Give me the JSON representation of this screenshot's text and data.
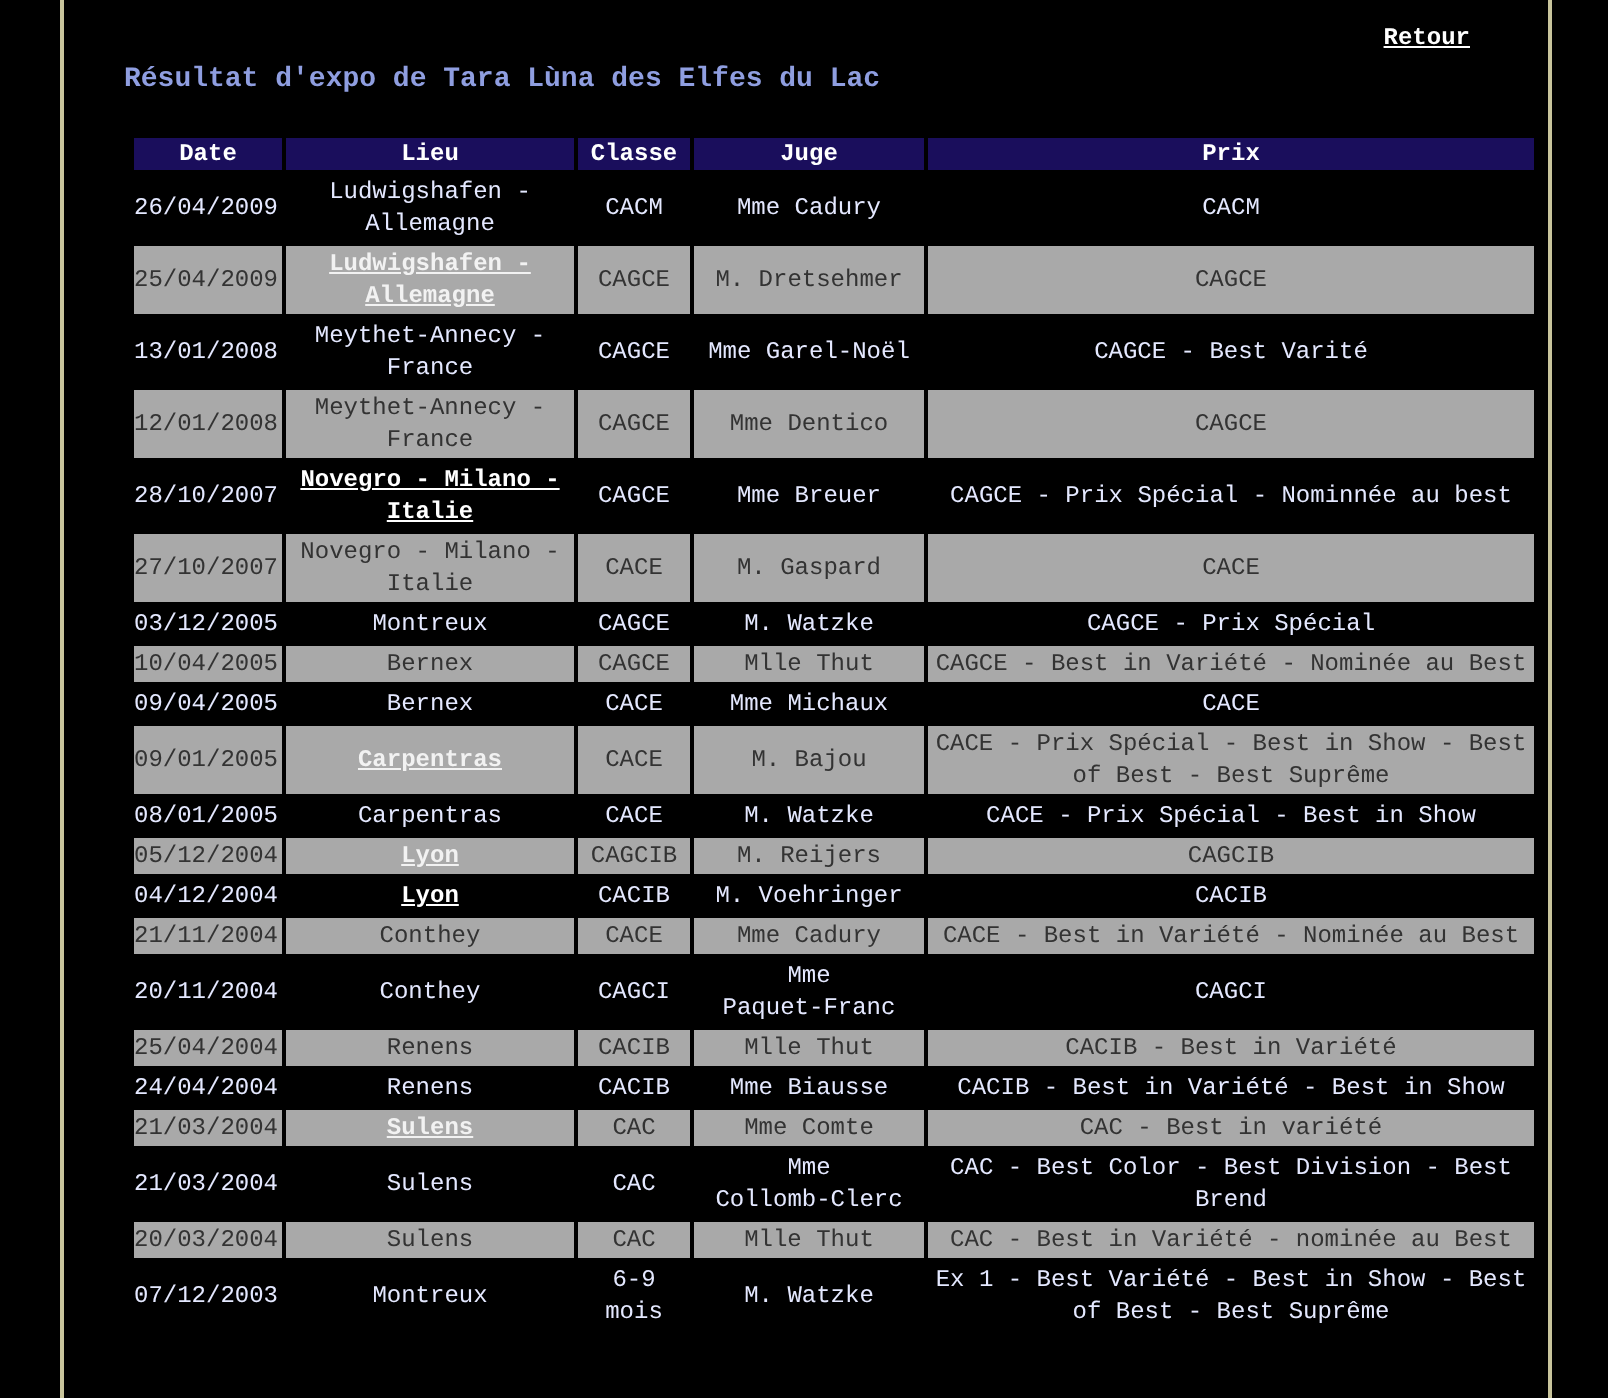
{
  "back_link": "Retour",
  "title": "Résultat d'expo de Tara Lùna des Elfes du Lac",
  "table": {
    "columns": [
      "Date",
      "Lieu",
      "Classe",
      "Juge",
      "Prix"
    ],
    "rows": [
      {
        "kind": "plain",
        "date": "26/04/2009",
        "lieu": "Ludwigshafen - Allemagne",
        "lieu_link": false,
        "classe": "CACM",
        "juge": "Mme Cadury",
        "prix": "CACM"
      },
      {
        "kind": "shaded",
        "date": "25/04/2009",
        "lieu": "Ludwigshafen - Allemagne",
        "lieu_link": true,
        "classe": "CAGCE",
        "juge": "M. Dretsehmer",
        "prix": "CAGCE"
      },
      {
        "kind": "plain",
        "date": "13/01/2008",
        "lieu": "Meythet-Annecy - France",
        "lieu_link": false,
        "classe": "CAGCE",
        "juge": "Mme Garel-Noël",
        "prix": "CAGCE - Best Varité"
      },
      {
        "kind": "shaded",
        "date": "12/01/2008",
        "lieu": "Meythet-Annecy - France",
        "lieu_link": false,
        "classe": "CAGCE",
        "juge": "Mme Dentico",
        "prix": "CAGCE"
      },
      {
        "kind": "plain",
        "date": "28/10/2007",
        "lieu": "Novegro - Milano - Italie",
        "lieu_link": true,
        "classe": "CAGCE",
        "juge": "Mme Breuer",
        "prix": "CAGCE - Prix Spécial - Nominnée au best"
      },
      {
        "kind": "shaded",
        "date": "27/10/2007",
        "lieu": "Novegro - Milano - Italie",
        "lieu_link": false,
        "classe": "CACE",
        "juge": "M. Gaspard",
        "prix": "CACE"
      },
      {
        "kind": "plain",
        "date": "03/12/2005",
        "lieu": "Montreux",
        "lieu_link": false,
        "classe": "CAGCE",
        "juge": "M. Watzke",
        "prix": "CAGCE - Prix Spécial"
      },
      {
        "kind": "shaded",
        "date": "10/04/2005",
        "lieu": "Bernex",
        "lieu_link": false,
        "classe": "CAGCE",
        "juge": "Mlle Thut",
        "prix": "CAGCE - Best in Variété - Nominée au Best"
      },
      {
        "kind": "plain",
        "date": "09/04/2005",
        "lieu": "Bernex",
        "lieu_link": false,
        "classe": "CACE",
        "juge": "Mme Michaux",
        "prix": "CACE"
      },
      {
        "kind": "shaded",
        "date": "09/01/2005",
        "lieu": "Carpentras",
        "lieu_link": true,
        "classe": "CACE",
        "juge": "M. Bajou",
        "prix": "CACE - Prix Spécial - Best in Show - Best of Best - Best Suprême"
      },
      {
        "kind": "plain",
        "date": "08/01/2005",
        "lieu": "Carpentras",
        "lieu_link": false,
        "classe": "CACE",
        "juge": "M. Watzke",
        "prix": "CACE - Prix Spécial - Best in Show"
      },
      {
        "kind": "shaded",
        "date": "05/12/2004",
        "lieu": "Lyon",
        "lieu_link": true,
        "classe": "CAGCIB",
        "juge": "M. Reijers",
        "prix": "CAGCIB"
      },
      {
        "kind": "plain",
        "date": "04/12/2004",
        "lieu": "Lyon",
        "lieu_link": true,
        "classe": "CACIB",
        "juge": "M. Voehringer",
        "prix": "CACIB"
      },
      {
        "kind": "shaded",
        "date": "21/11/2004",
        "lieu": "Conthey",
        "lieu_link": false,
        "classe": "CACE",
        "juge": "Mme Cadury",
        "prix": "CACE - Best in Variété - Nominée au Best"
      },
      {
        "kind": "plain",
        "date": "20/11/2004",
        "lieu": "Conthey",
        "lieu_link": false,
        "classe": "CAGCI",
        "juge": "Mme Paquet-Franc",
        "prix": "CAGCI"
      },
      {
        "kind": "shaded",
        "date": "25/04/2004",
        "lieu": "Renens",
        "lieu_link": false,
        "classe": "CACIB",
        "juge": "Mlle Thut",
        "prix": "CACIB - Best in Variété"
      },
      {
        "kind": "plain",
        "date": "24/04/2004",
        "lieu": "Renens",
        "lieu_link": false,
        "classe": "CACIB",
        "juge": "Mme Biausse",
        "prix": "CACIB - Best in Variété - Best in Show"
      },
      {
        "kind": "shaded",
        "date": "21/03/2004",
        "lieu": "Sulens",
        "lieu_link": true,
        "classe": "CAC",
        "juge": "Mme Comte",
        "prix": "CAC - Best in variété"
      },
      {
        "kind": "plain",
        "date": "21/03/2004",
        "lieu": "Sulens",
        "lieu_link": false,
        "classe": "CAC",
        "juge": "Mme Collomb-Clerc",
        "prix": "CAC - Best Color - Best Division - Best Brend"
      },
      {
        "kind": "shaded",
        "date": "20/03/2004",
        "lieu": "Sulens",
        "lieu_link": false,
        "classe": "CAC",
        "juge": "Mlle Thut",
        "prix": "CAC - Best in Variété - nominée au Best"
      },
      {
        "kind": "plain",
        "date": "07/12/2003",
        "lieu": "Montreux",
        "lieu_link": false,
        "classe": "6-9 mois",
        "juge": "M. Watzke",
        "prix": "Ex 1 - Best Variété - Best in Show - Best of Best - Best Suprême"
      }
    ]
  }
}
